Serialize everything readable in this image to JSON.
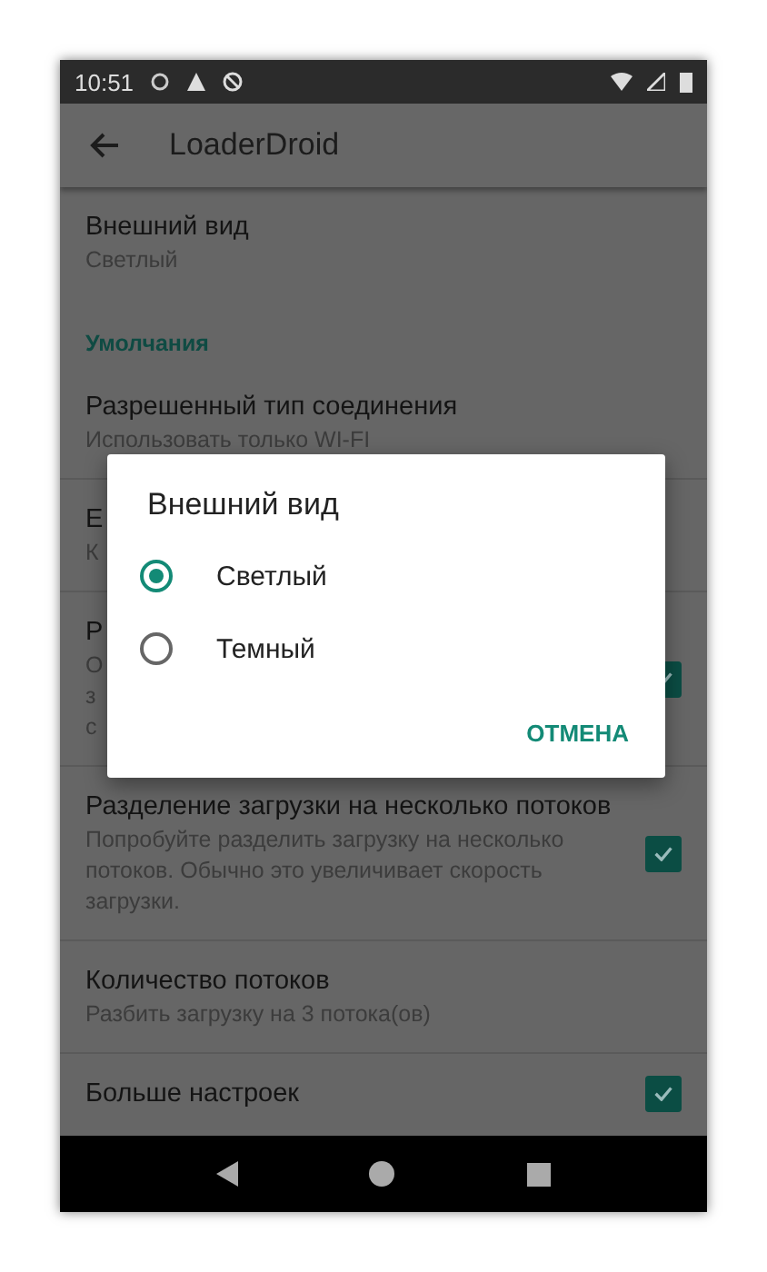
{
  "status_bar": {
    "time": "10:51"
  },
  "app_bar": {
    "title": "LoaderDroid"
  },
  "settings": [
    {
      "kind": "pref",
      "title": "Внешний вид",
      "subtitle": [
        "Светлый"
      ]
    },
    {
      "kind": "category",
      "title": "Умолчания"
    },
    {
      "kind": "pref",
      "title": "Разрешенный тип соединения",
      "subtitle": [
        "Использовать только WI-FI"
      ]
    },
    {
      "kind": "pref",
      "title": "Е",
      "subtitle": [
        "К"
      ]
    },
    {
      "kind": "checkbox",
      "title": "Р",
      "subtitle": [
        "О",
        "з",
        "с"
      ],
      "checked": true
    },
    {
      "kind": "checkbox",
      "title": "Разделение загрузки на несколько потоков",
      "subtitle": [
        "Попробуйте разделить загрузку на несколько",
        "потоков. Обычно это увеличивает скорость",
        "загрузки."
      ],
      "checked": true
    },
    {
      "kind": "pref",
      "title": "Количество потоков",
      "subtitle": [
        "Разбить загрузку на 3 потока(ов)"
      ]
    },
    {
      "kind": "checkbox",
      "title": "Больше настроек",
      "checked": true
    }
  ],
  "dialog": {
    "title": "Внешний вид",
    "options": [
      {
        "label": "Светлый",
        "selected": true
      },
      {
        "label": "Темный",
        "selected": false
      }
    ],
    "button": "ОТМЕНА"
  }
}
